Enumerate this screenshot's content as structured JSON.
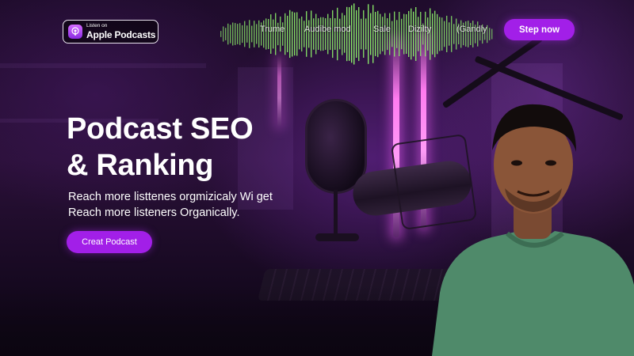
{
  "badge": {
    "small": "Listen on",
    "big": "Apple Podcasts",
    "icon": "podcast-icon"
  },
  "nav": {
    "items": [
      {
        "label": "Trume"
      },
      {
        "label": "Audibe mod"
      },
      {
        "label": "Sale"
      },
      {
        "label": "Dizilty"
      },
      {
        "label": "(Gandly"
      }
    ]
  },
  "header_button": "Step now",
  "hero": {
    "title_line1": "Podcast SEO",
    "title_line2": "& Ranking",
    "sub_line1": "Reach more listtenes orgmizicaly Wi get",
    "sub_line2": "Reach more listeners Organically.",
    "cta": "Creat Podcast"
  },
  "colors": {
    "accent": "#a21fe8",
    "waveform": "#8cf06a",
    "neon": "#ff7bf0"
  }
}
